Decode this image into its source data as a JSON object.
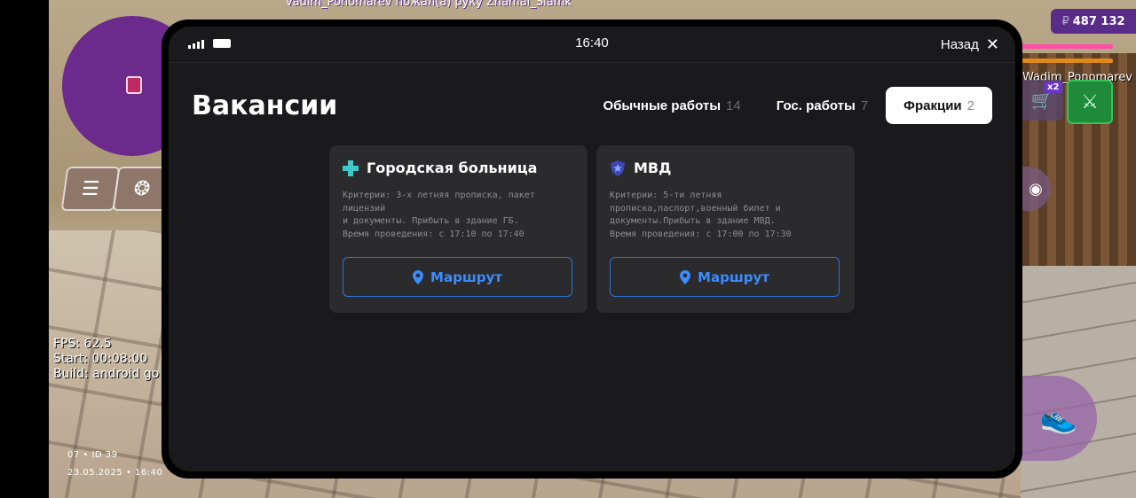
{
  "game": {
    "chat_line": "vadim_Ponomarev пожал(а) руку Zhamal_Slamk",
    "money": {
      "currency": "₽",
      "amount": "487 132"
    },
    "health_fraction": 1.0,
    "armor_fraction": 1.0,
    "player_name": "Wadim_Ponomarev",
    "shop_badge": "x2",
    "debug": {
      "fps": "FPS: 62.5",
      "start": "Start: 00:08:00",
      "build": "Build: android go"
    },
    "session_id": "07 • ID 39",
    "session_date": "23.05.2025 • 16:40",
    "icons": {
      "menu": "menu-icon",
      "lifebuoy": "lifebuoy-icon",
      "shop": "cart-icon",
      "weapon": "knife-icon",
      "camera": "camera-icon",
      "sprint": "sneaker-icon"
    }
  },
  "phone": {
    "status": {
      "time": "16:40"
    },
    "back_label": "Назад",
    "title": "Вакансии",
    "tabs": [
      {
        "label": "Обычные работы",
        "count": "14",
        "active": false
      },
      {
        "label": "Гос. работы",
        "count": "7",
        "active": false
      },
      {
        "label": "Фракции",
        "count": "2",
        "active": true
      }
    ],
    "vacancies": [
      {
        "icon": "medical-cross-icon",
        "icon_color": "#3fc8c8",
        "title": "Городская больница",
        "desc_lines": [
          "Критерии: 3-х летняя прописка, пакет лицензий",
          "и документы. Прибыть в здание ГБ.",
          "Время проведения: с 17:10 по 17:40"
        ],
        "route_label": "Маршрут"
      },
      {
        "icon": "police-shield-icon",
        "icon_color": "#4a5ad8",
        "title": "МВД",
        "desc_lines": [
          "Критерии: 5-ти летняя",
          "прописка,паспорт,военный билет и",
          "документы.Прибыть в здание МВД.",
          "Время проведения: с 17:00 по 17:30"
        ],
        "route_label": "Маршрут"
      }
    ]
  },
  "colors": {
    "accent_blue": "#3a8cff",
    "panel_bg": "#1a1a1c",
    "card_bg": "#2b2b2e",
    "money_bg": "#5a2c8a"
  }
}
